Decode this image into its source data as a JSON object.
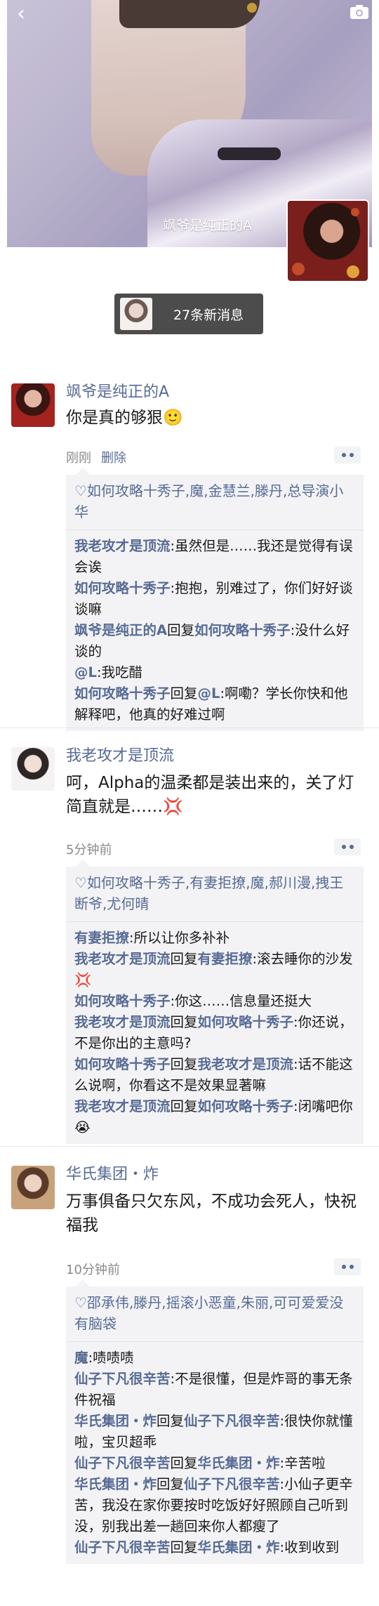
{
  "cover": {
    "username": "飒爷是纯正的A",
    "icons": {
      "back": "chevron-left-icon",
      "camera": "camera-icon"
    }
  },
  "notification": {
    "text": "27条新消息"
  },
  "moments": [
    {
      "name": "飒爷是纯正的A",
      "content": "你是真的够狠🙂",
      "time": "刚刚",
      "delete_label": "删除",
      "likes": "♡如何攻略十秀子,魔,金慧兰,滕丹,总导演小华",
      "comments": [
        {
          "user": "我老攻才是顶流",
          "text": ":虽然但是……我还是觉得有误会诶"
        },
        {
          "user": "如何攻略十秀子",
          "text": ":抱抱，别难过了，你们好好谈谈嘛"
        },
        {
          "user": "飒爷是纯正的A",
          "reply_word": "回复",
          "to": "如何攻略十秀子",
          "text": ":没什么好谈的"
        },
        {
          "user": "@L",
          "text": ":我吃醋"
        },
        {
          "user": "如何攻略十秀子",
          "reply_word": "回复",
          "to": "@L",
          "text": ":啊嘞？学长你快和他解释吧，他真的好难过啊"
        }
      ]
    },
    {
      "name": "我老攻才是顶流",
      "content": "呵，Alpha的温柔都是装出来的，关了灯简直就是……💢",
      "time": "5分钟前",
      "likes": "♡如何攻略十秀子,有妻拒撩,魔,郝川漫,拽王断爷,尤何晴",
      "comments": [
        {
          "user": "有妻拒撩",
          "text": ":所以让你多补补"
        },
        {
          "user": "我老攻才是顶流",
          "reply_word": "回复",
          "to": "有妻拒撩",
          "text": ":滚去睡你的沙发💢"
        },
        {
          "user": "如何攻略十秀子",
          "text": ":你这……信息量还挺大"
        },
        {
          "user": "我老攻才是顶流",
          "reply_word": "回复",
          "to": "如何攻略十秀子",
          "text": ":你还说，不是你出的主意吗?"
        },
        {
          "user": "如何攻略十秀子",
          "reply_word": "回复",
          "to": "我老攻才是顶流",
          "text": ":话不能这么说啊，你看这不是效果显著嘛"
        },
        {
          "user": "我老攻才是顶流",
          "reply_word": "回复",
          "to": "如何攻略十秀子",
          "text": ":闭嘴吧你😭"
        }
      ]
    },
    {
      "name": "华氏集团・炸",
      "content": "万事俱备只欠东风，不成功会死人，快祝福我",
      "time": "10分钟前",
      "likes": "♡邵承伟,滕丹,摇滚小恶童,朱丽,可可爱爱没有脑袋",
      "comments": [
        {
          "user": "魔",
          "text": ":啧啧啧"
        },
        {
          "user": "仙子下凡很辛苦",
          "text": ":不是很懂，但是炸哥的事无条件祝福"
        },
        {
          "user": "华氏集团・炸",
          "reply_word": "回复",
          "to": "仙子下凡很辛苦",
          "text": ":很快你就懂啦，宝贝超乖"
        },
        {
          "user": "仙子下凡很辛苦",
          "reply_word": "回复",
          "to": "华氏集团・炸",
          "text": ":辛苦啦"
        },
        {
          "user": "华氏集团・炸",
          "reply_word": "回复",
          "to": "仙子下凡很辛苦",
          "text": ":小仙子更辛苦，我没在家你要按时吃饭好好照顾自己听到没，别我出差一趟回来你人都瘦了"
        },
        {
          "user": "仙子下凡很辛苦",
          "reply_word": "回复",
          "to": "华氏集团・炸",
          "text": ":收到收到"
        }
      ]
    }
  ],
  "colors": {
    "link": "#576b95",
    "comment_bg": "#f3f3f5"
  }
}
